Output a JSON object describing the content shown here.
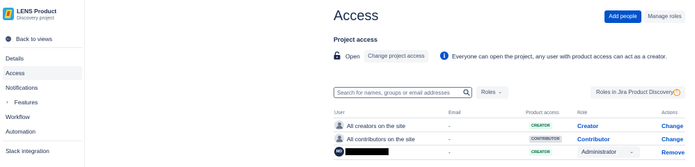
{
  "sidebar": {
    "project_name": "LENS Product",
    "project_type": "Discovery project",
    "back_label": "Back to views",
    "items": [
      {
        "label": "Details"
      },
      {
        "label": "Access"
      },
      {
        "label": "Notifications"
      },
      {
        "label": "Features"
      },
      {
        "label": "Workflow"
      },
      {
        "label": "Automation"
      },
      {
        "label": "Slack integration"
      }
    ]
  },
  "header": {
    "title": "Access",
    "add_people_label": "Add people",
    "manage_roles_label": "Manage roles"
  },
  "project_access": {
    "heading": "Project access",
    "status": "Open",
    "change_label": "Change project access",
    "info_text": "Everyone can open the project, any user with product access can act as a creator."
  },
  "search": {
    "placeholder": "Search for names, groups or email addresses"
  },
  "filters": {
    "roles_label": "Roles",
    "roles_info_label": "Roles in Jira Product Discovery"
  },
  "table": {
    "columns": [
      "User",
      "Email",
      "Product access",
      "Role",
      "Actions"
    ],
    "rows": [
      {
        "avatar": "",
        "user": "All creators on the site",
        "email": "-",
        "access": "CREATOR",
        "role": "Creator",
        "action": "Change"
      },
      {
        "avatar": "",
        "user": "All contributors on the site",
        "email": "-",
        "access": "CONTRIBUTOR",
        "role": "Contributor",
        "action": "Change"
      },
      {
        "avatar": "MD",
        "user": "",
        "email": "-",
        "access": "CREATOR",
        "role": "Administrator",
        "action": "Remove"
      }
    ]
  },
  "colors": {
    "primary": "#0052cc",
    "text": "#172b4d",
    "creator_badge_bg": "#e3fcef",
    "creator_badge_text": "#006644",
    "contributor_badge_bg": "#dfe1e6",
    "warning": "#ff8b00"
  }
}
